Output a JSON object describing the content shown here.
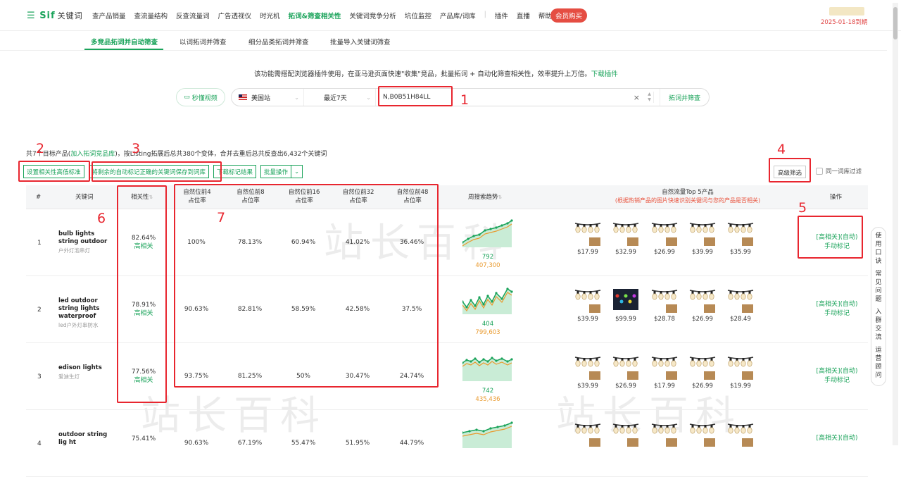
{
  "nav": {
    "logo": "Sif",
    "logo_sub": "关键词",
    "items": [
      "查产品销量",
      "查流量结构",
      "反查流量词",
      "广告透视仪",
      "时光机",
      "拓词&筛查相关性",
      "关键词竞争分析",
      "坑位监控",
      "产品库/词库",
      "|",
      "插件",
      "直播",
      "帮助"
    ],
    "active_index": 5,
    "vip_label": "会员购买",
    "expire": "2025-01-18到期"
  },
  "tabs": [
    "多竞品拓词并自动筛查",
    "以词拓词并筛查",
    "细分品类拓词并筛查",
    "批量导入关键词筛查"
  ],
  "description": {
    "text": "该功能需搭配浏览器插件使用，在亚马逊页面快速\"收集\"竞品，批量拓词 + 自动化筛查相关性，效率提升上万倍。",
    "link": "下载插件"
  },
  "search": {
    "video_label": "秒懂视频",
    "site": "美国站",
    "period": "最近7天",
    "asin": "N,B0B51H84LL",
    "submit": "拓词并筛查"
  },
  "summary": {
    "prefix": "共7",
    "mid": "个目标产品(",
    "link": "加入拓词竞品库",
    "suffix": ")，按Listing拓展后总共380个变体，合并去重后总共反查出6,432个关键词"
  },
  "actions": [
    "设置相关性高低标准",
    "将剩余的自动标记正确的关键词保存到词库",
    "下载标记结果",
    "批量操作"
  ],
  "filters": {
    "advanced": "高级筛选",
    "same_root": "同一词库过滤"
  },
  "table": {
    "headers": {
      "idx": "#",
      "keyword": "关键词",
      "relevance": "相关性",
      "p4": [
        "自然位前4",
        "占位率"
      ],
      "p8": [
        "自然位前8",
        "占位率"
      ],
      "p16": [
        "自然位前16",
        "占位率"
      ],
      "p32": [
        "自然位前32",
        "占位率"
      ],
      "p48": [
        "自然位前48",
        "占位率"
      ],
      "trend": "周搜索趋势",
      "top5": "自然流量Top 5产品",
      "top5_note": "(根据热销产品的图片快速识别关键词与您的产品是否相关)",
      "op": "操作"
    },
    "rows": [
      {
        "idx": "1",
        "kw": "bulb lights string outdoor",
        "kw_cn": "户外灯泡串灯",
        "rel": "82.64%",
        "rel_label": "高相关",
        "p4": "100%",
        "p8": "78.13%",
        "p16": "60.94%",
        "p32": "41.02%",
        "p48": "36.46%",
        "trend_a": "792",
        "trend_b": "407,300",
        "prices": [
          "$17.99",
          "$32.99",
          "$26.99",
          "$39.99",
          "$35.99"
        ],
        "op1": "[高相关](自动)",
        "op2": "手动标记"
      },
      {
        "idx": "2",
        "kw": "led outdoor string lights waterproof",
        "kw_cn": "led户外灯串防水",
        "rel": "78.91%",
        "rel_label": "高相关",
        "p4": "90.63%",
        "p8": "82.81%",
        "p16": "58.59%",
        "p32": "42.58%",
        "p48": "37.5%",
        "trend_a": "404",
        "trend_b": "799,603",
        "prices": [
          "$39.99",
          "$99.99",
          "$28.78",
          "$26.99",
          "$28.49"
        ],
        "op1": "[高相关](自动)",
        "op2": "手动标记"
      },
      {
        "idx": "3",
        "kw": "edison lights",
        "kw_cn": "爱迪生灯",
        "rel": "77.56%",
        "rel_label": "高相关",
        "p4": "93.75%",
        "p8": "81.25%",
        "p16": "50%",
        "p32": "30.47%",
        "p48": "24.74%",
        "trend_a": "742",
        "trend_b": "435,436",
        "prices": [
          "$39.99",
          "$26.99",
          "$17.99",
          "$26.99",
          "$19.99"
        ],
        "op1": "[高相关](自动)",
        "op2": "手动标记"
      },
      {
        "idx": "4",
        "kw": "outdoor string lig ht",
        "kw_cn": "",
        "rel": "75.41%",
        "rel_label": "",
        "p4": "90.63%",
        "p8": "67.19%",
        "p16": "55.47%",
        "p32": "51.95%",
        "p48": "44.79%",
        "trend_a": "",
        "trend_b": "",
        "prices": [
          "",
          "",
          "",
          "",
          ""
        ],
        "op1": "[高相关](自动)",
        "op2": ""
      }
    ]
  },
  "annotations": [
    "1",
    "2",
    "3",
    "4",
    "5",
    "6",
    "7"
  ],
  "side_widget": [
    "使用口诀",
    "常见问题",
    "入群交流",
    "运营顾问"
  ],
  "watermark": "站长百科",
  "colors": {
    "brand": "#1aa35a",
    "highlight": "#e8262f",
    "orange": "#e99a2e"
  }
}
